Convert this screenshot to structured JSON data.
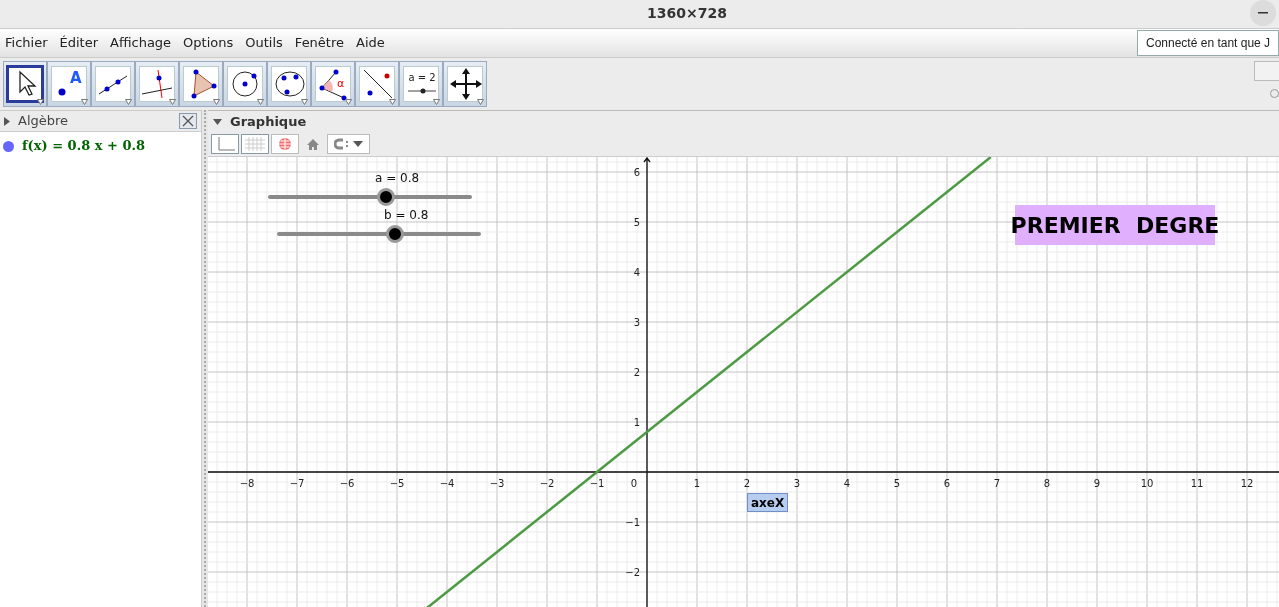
{
  "window": {
    "title": "1360×728"
  },
  "menu": [
    "Fichier",
    "Éditer",
    "Affichage",
    "Options",
    "Outils",
    "Fenêtre",
    "Aide"
  ],
  "account_button": "Connecté en tant que J",
  "tools": [
    {
      "kind": "move",
      "selected": true
    },
    {
      "kind": "point",
      "selected": false,
      "label": "A"
    },
    {
      "kind": "line",
      "selected": false
    },
    {
      "kind": "perpendicular",
      "selected": false
    },
    {
      "kind": "polygon",
      "selected": false
    },
    {
      "kind": "circle",
      "selected": false
    },
    {
      "kind": "conic",
      "selected": false
    },
    {
      "kind": "angle",
      "selected": false,
      "label": "α"
    },
    {
      "kind": "reflect",
      "selected": false
    },
    {
      "kind": "slider",
      "selected": false,
      "label": "a = 2"
    },
    {
      "kind": "move-view",
      "selected": false
    }
  ],
  "algebra": {
    "title": "Algèbre",
    "expanded": false,
    "items": [
      {
        "text": "f(x) = 0.8 x + 0.8",
        "color": "#6666ff"
      }
    ]
  },
  "graphics": {
    "title": "Graphique",
    "expanded": true,
    "sliders": [
      {
        "label": "a = 0.8",
        "level": 0.58
      },
      {
        "label": "b = 0.8",
        "level": 0.58
      }
    ],
    "origin_label": "0",
    "texts": [
      {
        "kind": "title",
        "text": "PREMIER  DEGRE"
      },
      {
        "kind": "axis-label",
        "text": "axeX"
      }
    ],
    "chart_data": {
      "type": "line",
      "grid": true,
      "x": [
        -4.425,
        6.875
      ],
      "series": [
        {
          "color": "#4c9a44",
          "values": [
            -2.74,
            6.3
          ]
        }
      ],
      "xlim": [
        -8.78,
        12.64
      ],
      "ylim": [
        -2.74,
        6.3
      ],
      "xticks": [
        {
          "value": -8,
          "label": "−8"
        },
        {
          "value": -7,
          "label": "−7"
        },
        {
          "value": -6,
          "label": "−6"
        },
        {
          "value": -5,
          "label": "−5"
        },
        {
          "value": -4,
          "label": "−4"
        },
        {
          "value": -3,
          "label": "−3"
        },
        {
          "value": -2,
          "label": "−2"
        },
        {
          "value": -1,
          "label": "−1"
        },
        1,
        2,
        3,
        4,
        5,
        6,
        7,
        8,
        9,
        10,
        11,
        12
      ],
      "yticks": [
        {
          "value": -2,
          "label": "−2"
        },
        {
          "value": -1,
          "label": "−1"
        },
        1,
        2,
        3,
        4,
        5,
        6
      ]
    }
  }
}
